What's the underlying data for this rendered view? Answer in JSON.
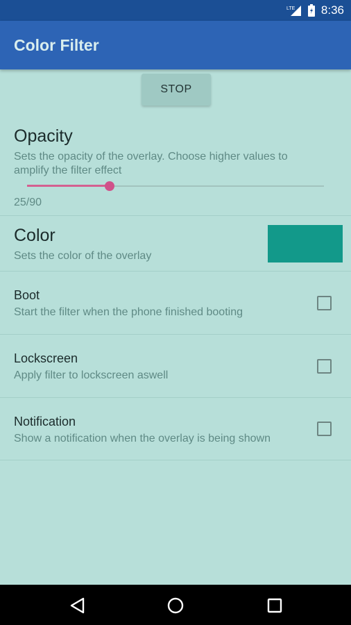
{
  "status_bar": {
    "time": "8:36",
    "network": "LTE"
  },
  "app_bar": {
    "title": "Color Filter"
  },
  "stop_button": {
    "label": "STOP"
  },
  "opacity": {
    "title": "Opacity",
    "summary_line1": "Sets the opacity of the overlay. Choose higher values to",
    "summary_line2": "amplify the filter effect",
    "value_text": "25/90",
    "value": 25,
    "max": 90
  },
  "color": {
    "title": "Color",
    "summary": "Sets the color of the overlay",
    "swatch": "#12998a"
  },
  "prefs": [
    {
      "title": "Boot",
      "summary": "Start the filter when the phone finished booting",
      "checked": false
    },
    {
      "title": "Lockscreen",
      "summary": "Apply filter to lockscreen aswell",
      "checked": false
    },
    {
      "title": "Notification",
      "summary": "Show a notification when the overlay is being shown",
      "checked": false
    }
  ],
  "colors": {
    "app_bar": "#2d64b5",
    "status_bar": "#1b4f95",
    "background": "#b7dfd9",
    "accent": "#d0528a"
  },
  "nav": {
    "back": "back-icon",
    "home": "home-icon",
    "recents": "recents-icon"
  }
}
